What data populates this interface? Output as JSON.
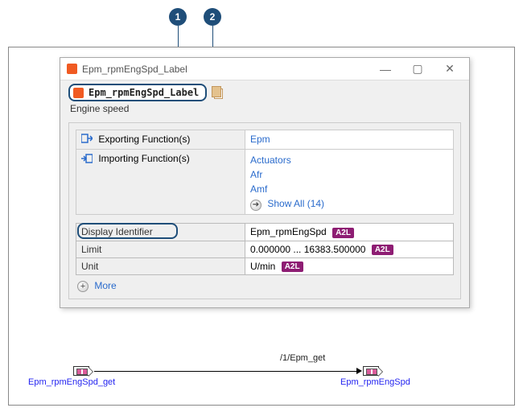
{
  "callouts": {
    "c1": "1",
    "c2": "2"
  },
  "window": {
    "title": "Epm_rpmEngSpd_Label",
    "header_label": "Epm_rpmEngSpd_Label",
    "subtitle": "Engine speed"
  },
  "functions": {
    "exporting_label": "Exporting Function(s)",
    "importing_label": "Importing Function(s)",
    "exporting_value": "Epm",
    "importing_values": [
      "Actuators",
      "Afr",
      "Amf"
    ],
    "show_all": "Show All (14)"
  },
  "props": {
    "display_id_label": "Display Identifier",
    "display_id_value": "Epm_rpmEngSpd",
    "limit_label": "Limit",
    "limit_value": "0.000000 ... 16383.500000",
    "unit_label": "Unit",
    "unit_value": "U/min",
    "a2l": "A2L",
    "more": "More"
  },
  "diagram": {
    "left_label": "Epm_rpmEngSpd_get",
    "right_label": "Epm_rpmEngSpd",
    "path_label": "/1/Epm_get"
  }
}
